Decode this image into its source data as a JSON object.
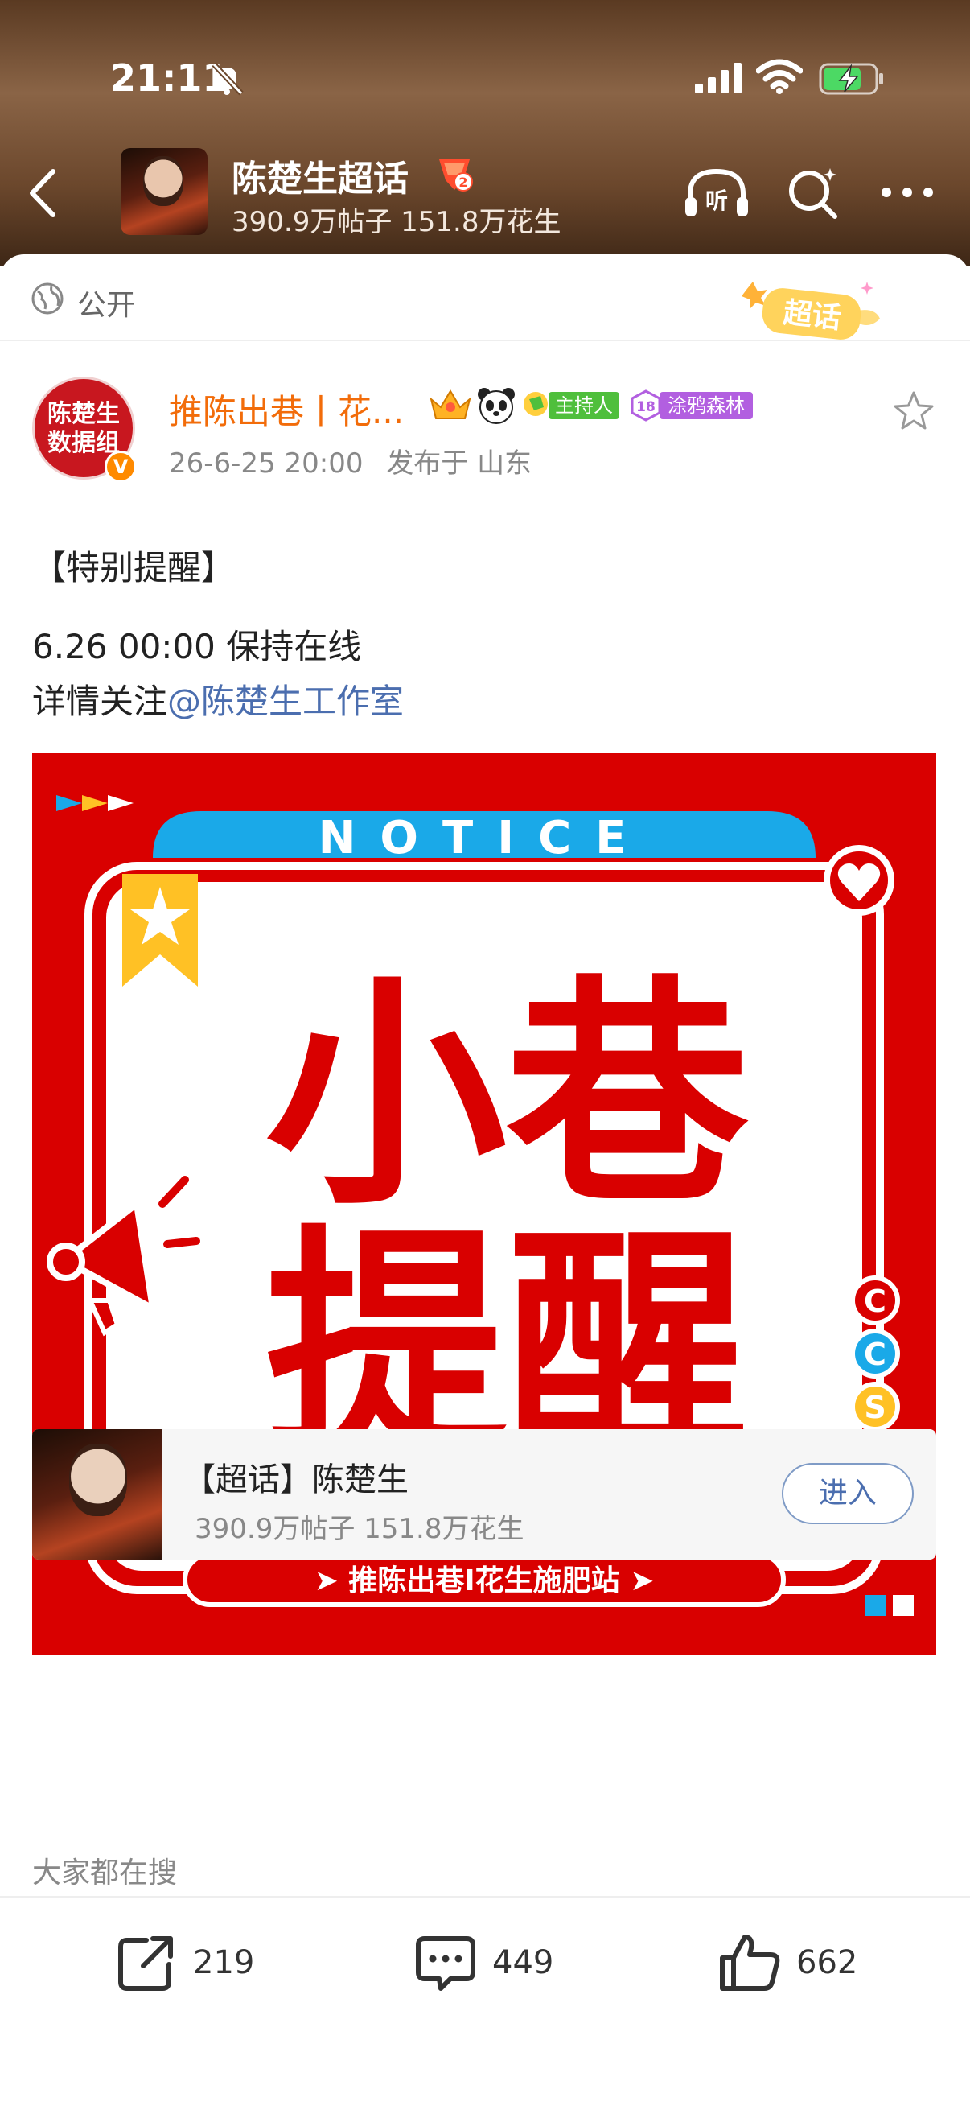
{
  "status_bar": {
    "time": "21:11"
  },
  "header": {
    "title": "陈楚生超话",
    "stats": "390.9万帖子 151.8万花生"
  },
  "post": {
    "visibility": "公开",
    "sticker_text": "超话",
    "avatar_text_1": "陈楚生",
    "avatar_text_2": "数据组",
    "verified_mark": "V",
    "author": "推陈出巷丨花...",
    "host_badge": "主持人",
    "group_level": "18",
    "group_badge": "涂鸦森林",
    "time": "26-6-25 20:00",
    "location": "发布于 山东",
    "line1": "【特别提醒】",
    "line2": "6.26 00:00 保持在线",
    "line3_prefix": "详情关注",
    "mention": "@陈楚生工作室"
  },
  "notice_image": {
    "header": "NOTICE",
    "main_line1": "小巷",
    "main_line2": "提醒",
    "footer": "➤ 推陈出巷I花生施肥站 ➤",
    "badge_letters": [
      "C",
      "C",
      "S"
    ]
  },
  "topic_card": {
    "title": "【超话】陈楚生",
    "stats": "390.9万帖子 151.8万花生",
    "enter_label": "进入"
  },
  "search_hint": "大家都在搜",
  "actions": {
    "share_count": "219",
    "comment_count": "449",
    "like_count": "662"
  },
  "colors": {
    "accent_orange": "#f26c0a",
    "notice_red": "#d90000",
    "notice_blue": "#1aa9e8",
    "mention_blue": "#4b6eaf"
  }
}
